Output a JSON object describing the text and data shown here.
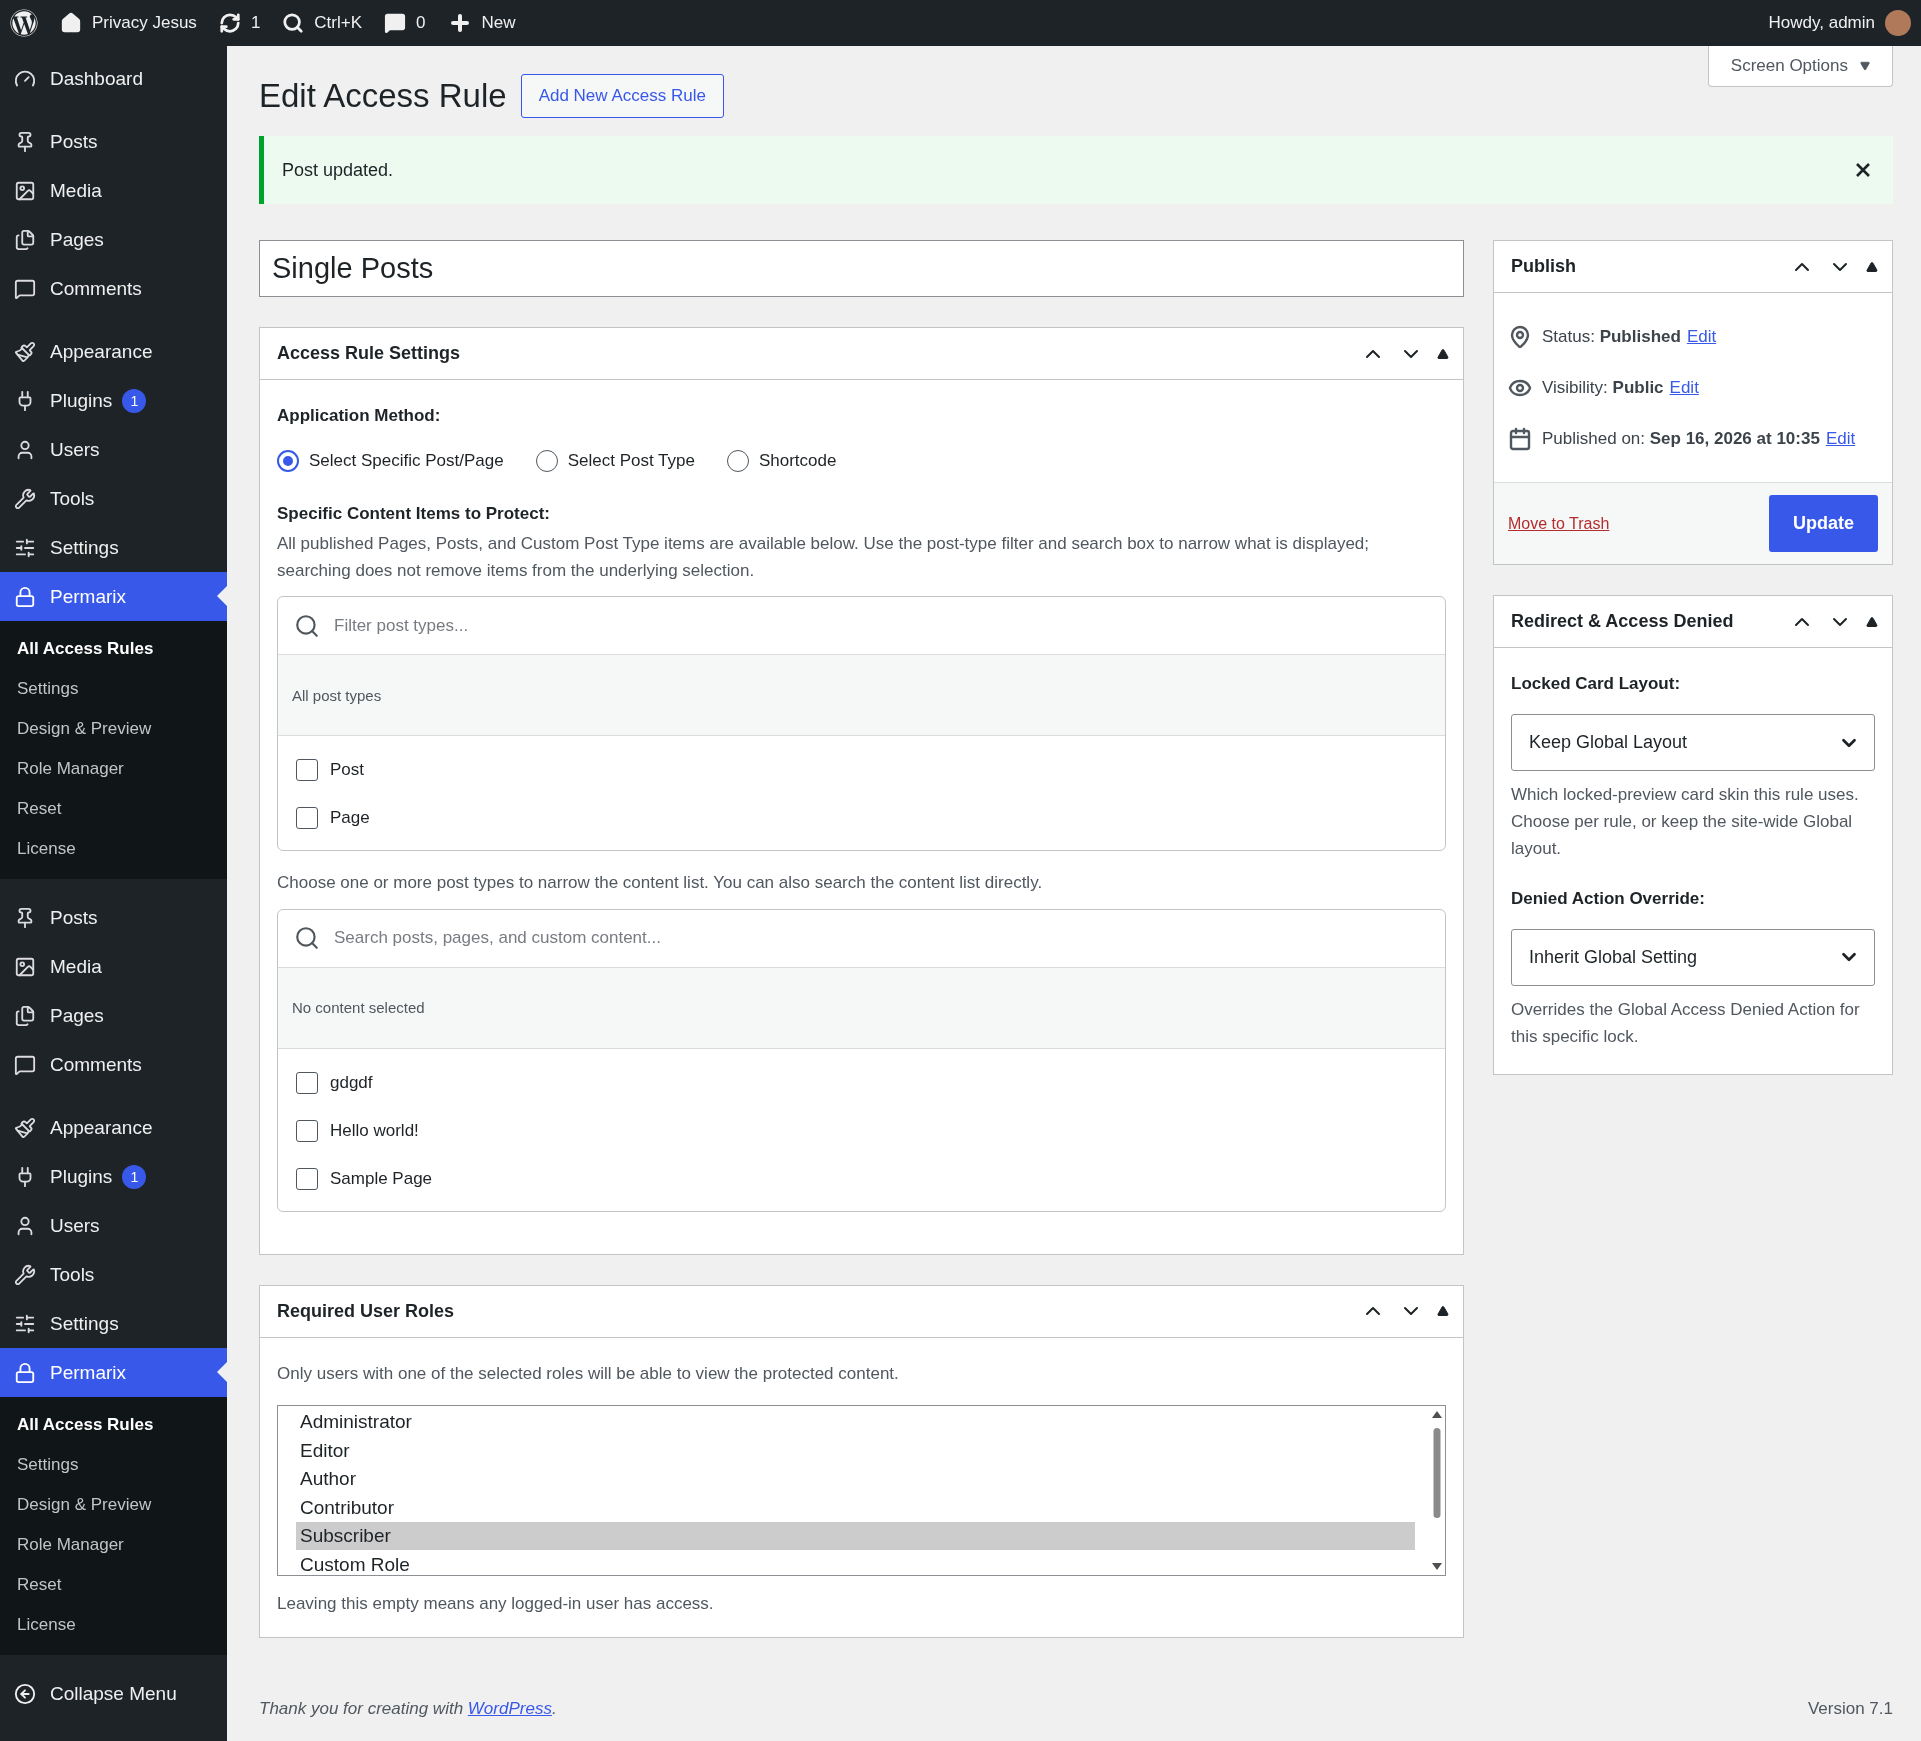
{
  "admin_bar": {
    "site": "Privacy Jesus",
    "updates": "1",
    "search": "Ctrl+K",
    "comments": "0",
    "new": "New",
    "greeting": "Howdy, admin"
  },
  "sidebar": {
    "sections": [
      [
        {
          "label": "Dashboard",
          "selected": false
        }
      ],
      [
        {
          "label": "Posts",
          "selected": false
        },
        {
          "label": "Media",
          "selected": false
        },
        {
          "label": "Pages",
          "selected": false
        },
        {
          "label": "Comments",
          "selected": false
        }
      ],
      [
        {
          "label": "Appearance",
          "selected": false
        },
        {
          "label": "Plugins",
          "selected": false,
          "badge": "1"
        },
        {
          "label": "Users",
          "selected": false
        },
        {
          "label": "Tools",
          "selected": false
        },
        {
          "label": "Settings",
          "selected": false
        },
        {
          "label": "Permarix",
          "selected": true,
          "children": [
            {
              "label": "All Access Rules",
              "selected": true
            },
            {
              "label": "Settings",
              "selected": false
            },
            {
              "label": "Design & Preview",
              "selected": false
            },
            {
              "label": "Role Manager",
              "selected": false
            },
            {
              "label": "Reset",
              "selected": false
            },
            {
              "label": "License",
              "selected": false
            }
          ]
        }
      ],
      [
        {
          "label": "Posts",
          "selected": false
        },
        {
          "label": "Media",
          "selected": false
        },
        {
          "label": "Pages",
          "selected": false
        },
        {
          "label": "Comments",
          "selected": false
        }
      ],
      [
        {
          "label": "Appearance",
          "selected": false
        },
        {
          "label": "Plugins",
          "selected": false,
          "badge": "1"
        },
        {
          "label": "Users",
          "selected": false
        },
        {
          "label": "Tools",
          "selected": false
        },
        {
          "label": "Settings",
          "selected": false
        },
        {
          "label": "Permarix",
          "selected": true,
          "children": [
            {
              "label": "All Access Rules",
              "selected": true
            },
            {
              "label": "Settings",
              "selected": false
            },
            {
              "label": "Design & Preview",
              "selected": false
            },
            {
              "label": "Role Manager",
              "selected": false
            },
            {
              "label": "Reset",
              "selected": false
            },
            {
              "label": "License",
              "selected": false
            }
          ]
        }
      ]
    ],
    "collapse": "Collapse Menu"
  },
  "page": {
    "title": "Edit Access Rule",
    "add_new": "Add New Access Rule",
    "screen_options": "Screen Options"
  },
  "notice": {
    "text": "Post updated."
  },
  "post_title": {
    "value": "Single Posts"
  },
  "access_rule_settings": {
    "title": "Access Rule Settings",
    "method_label": "Application Method:",
    "methods": [
      {
        "label": "Select Specific Post/Page",
        "selected": true
      },
      {
        "label": "Select Post Type",
        "selected": false
      },
      {
        "label": "Shortcode",
        "selected": false
      }
    ],
    "items_heading": "Specific Content Items to Protect:",
    "items_help": "All published Pages, Posts, and Custom Post Type items are available below. Use the post-type filter and search box to narrow what is displayed; searching does not remove items from the underlying selection.",
    "post_type_filter": {
      "placeholder": "Filter post types...",
      "summary": "All post types",
      "options": [
        {
          "label": "Post",
          "checked": false
        },
        {
          "label": "Page",
          "checked": false
        }
      ]
    },
    "filter_help": "Choose one or more post types to narrow the content list. You can also search the content list directly.",
    "content_search": {
      "placeholder": "Search posts, pages, and custom content...",
      "summary": "No content selected",
      "options": [
        {
          "label": "gdgdf",
          "checked": false
        },
        {
          "label": "Hello world!",
          "checked": false
        },
        {
          "label": "Sample Page",
          "checked": false
        }
      ]
    }
  },
  "required_roles": {
    "title": "Required User Roles",
    "help": "Only users with one of the selected roles will be able to view the protected content.",
    "roles": [
      {
        "label": "Administrator",
        "selected": false
      },
      {
        "label": "Editor",
        "selected": false
      },
      {
        "label": "Author",
        "selected": false
      },
      {
        "label": "Contributor",
        "selected": false
      },
      {
        "label": "Subscriber",
        "selected": true
      },
      {
        "label": "Custom Role",
        "selected": false
      }
    ],
    "note": "Leaving this empty means any logged-in user has access."
  },
  "publish": {
    "title": "Publish",
    "rows": [
      {
        "text": "Status: **Published**",
        "link": "Edit"
      },
      {
        "text": "Visibility: **Public**",
        "link": "Edit"
      },
      {
        "text": "Published on: **Sep 16, 2026 at 10:35**",
        "link": "Edit"
      }
    ],
    "trash": "Move to Trash",
    "update": "Update"
  },
  "redirect": {
    "title": "Redirect & Access Denied",
    "fields": [
      {
        "label": "Locked Card Layout:",
        "value": "Keep Global Layout",
        "help": "Which locked-preview card skin this rule uses. Choose per rule, or keep the site-wide Global layout."
      },
      {
        "label": "Denied Action Override:",
        "value": "Inherit Global Setting",
        "help": "Overrides the Global Access Denied Action for this specific lock."
      }
    ]
  },
  "footer": {
    "thanks": "Thank you for creating with ",
    "link": "WordPress",
    "suffix": ".",
    "version": "Version 7.1"
  }
}
